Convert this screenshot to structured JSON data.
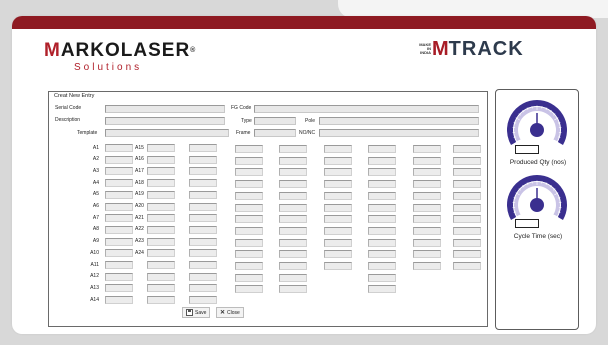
{
  "brand": {
    "logo_prefix": "M",
    "logo_main": "ARKOLASER",
    "logo_reg": "®",
    "logo_sub": "Solutions",
    "mtrack_badge_line1": "MAKE",
    "mtrack_badge_line2": "IN",
    "mtrack_badge_line3": "INDIA",
    "mtrack_m": "M",
    "mtrack_rest": "TRACK"
  },
  "colors": {
    "brand_red": "#8e1a22",
    "gauge_purple": "#3a2f8f",
    "gauge_light": "#c9c3e6"
  },
  "form": {
    "title": "Creat New Entry",
    "fields": {
      "serial_code": {
        "label": "Serial Code",
        "value": ""
      },
      "description": {
        "label": "Description",
        "value": ""
      },
      "template": {
        "label": "Template",
        "value": ""
      },
      "fg_code": {
        "label": "FG Code",
        "value": ""
      },
      "type": {
        "label": "Type",
        "value": ""
      },
      "frame": {
        "label": "Frame",
        "value": ""
      },
      "pole": {
        "label": "Pole",
        "value": ""
      },
      "nonc": {
        "label": "NO/NC",
        "value": ""
      }
    },
    "left_labels": [
      "A1",
      "A2",
      "A3",
      "A4",
      "A5",
      "A6",
      "A7",
      "A8",
      "A9",
      "A10",
      "A11",
      "A12",
      "A13",
      "A14"
    ],
    "mid_labels": [
      "A15",
      "A16",
      "A17",
      "A18",
      "A19",
      "A20",
      "A21",
      "A22",
      "A23",
      "A24"
    ],
    "save_label": "Save",
    "close_label": "Close"
  },
  "gauges": {
    "produced": {
      "label": "Produced Qty (nos)",
      "value": "",
      "level": 0.5
    },
    "cycle": {
      "label": "Cycle Time (sec)",
      "value": "",
      "level": 0.5
    }
  }
}
